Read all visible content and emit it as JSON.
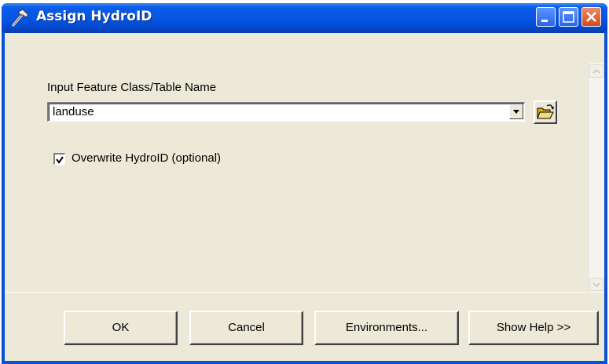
{
  "window": {
    "title": "Assign HydroID",
    "title_icon": "hammer-icon",
    "controls": [
      "minimize-icon",
      "maximize-icon",
      "close-icon"
    ]
  },
  "parameters": {
    "input_label": "Input Feature Class/Table Name",
    "input_value": "landuse",
    "browse_icon": "open-folder-icon",
    "overwrite_label": "Overwrite HydroID (optional)",
    "overwrite_checked": true
  },
  "buttons": {
    "ok": "OK",
    "cancel": "Cancel",
    "environments": "Environments...",
    "show_help": "Show Help >>"
  },
  "colors": {
    "titlebar": "#0656e4",
    "dialog_background": "#ece9d8",
    "close_button": "#d14b1f"
  }
}
